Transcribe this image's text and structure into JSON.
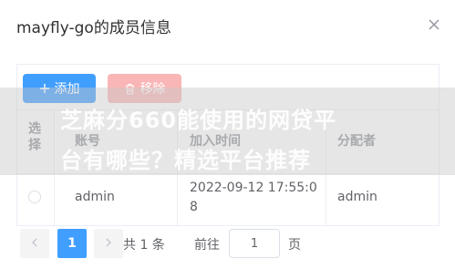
{
  "dialog": {
    "title": "mayfly-go的成员信息",
    "close_icon": "close-icon"
  },
  "toolbar": {
    "add_label": "添加",
    "remove_label": "移除",
    "add_color": "#409eff",
    "remove_color": "#fab6b6"
  },
  "table": {
    "headers": {
      "select": "选择",
      "account": "账号",
      "join_time": "加入时间",
      "assigner": "分配者"
    },
    "rows": [
      {
        "account": "admin",
        "join_time": "2022-09-12 17:55:08",
        "assigner": "admin"
      }
    ]
  },
  "watermark": {
    "line1": "芝麻分660能使用的网贷平",
    "line2": "台有哪些？精选平台推荐"
  },
  "pagination": {
    "total_text": "共 1 条",
    "current_page": "1",
    "goto_label": "前往",
    "goto_value": "1",
    "page_suffix": "页"
  }
}
